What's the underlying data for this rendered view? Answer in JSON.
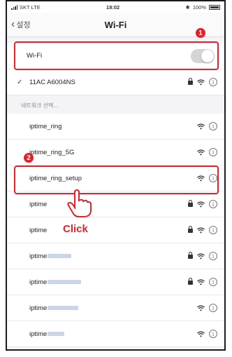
{
  "status_bar": {
    "carrier": "SKT  LTE",
    "time": "18:02",
    "battery_text": "100%"
  },
  "nav": {
    "back_label": "설정",
    "title": "Wi-Fi"
  },
  "wifi_toggle": {
    "label": "Wi-Fi",
    "enabled": false
  },
  "connected_network": {
    "name": "11AC A6004NS",
    "secured": true
  },
  "section_header": "네트워크 선택...",
  "networks": [
    {
      "name": "iptime_ring",
      "secured": false
    },
    {
      "name": "iptime_ring_5G",
      "secured": false
    },
    {
      "name": "iptime_ring_setup",
      "secured": false
    },
    {
      "name": "iptime",
      "secured": true
    },
    {
      "name": "iptime",
      "secured": true
    },
    {
      "name": "iptime",
      "secured": true
    },
    {
      "name": "iptime",
      "secured": true
    },
    {
      "name": "iptime",
      "secured": false
    },
    {
      "name": "iptime",
      "secured": false
    }
  ],
  "annotations": {
    "marker_1": "1",
    "marker_2": "2",
    "click_label": "Click"
  },
  "colors": {
    "accent": "#e0232b"
  }
}
